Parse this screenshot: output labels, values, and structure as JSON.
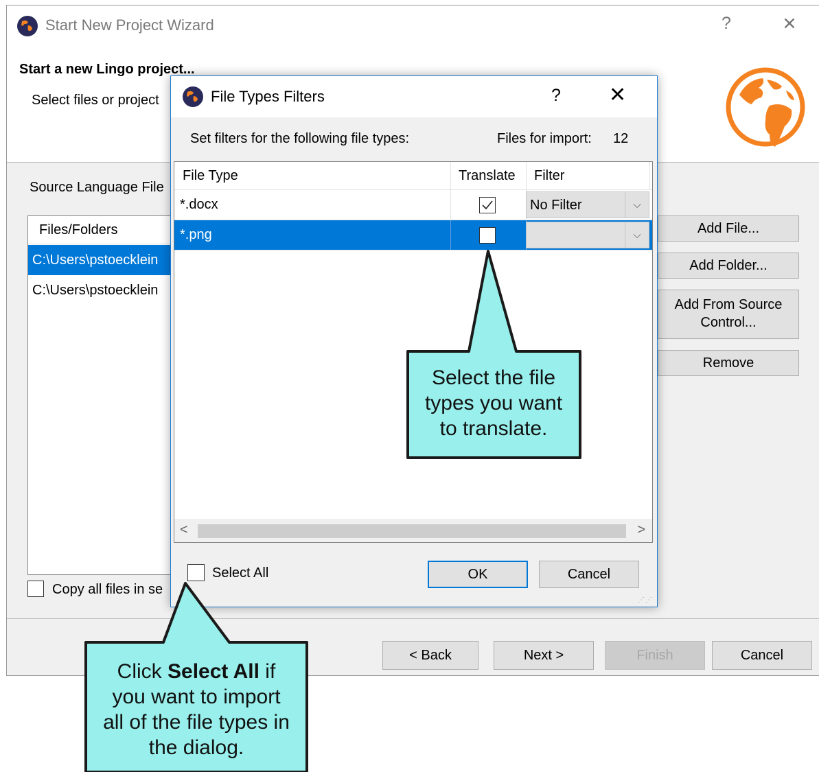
{
  "wizard": {
    "title": "Start New Project Wizard",
    "help_glyph": "?",
    "close_glyph": "✕",
    "header_title": "Start a new Lingo project...",
    "header_subtitle": "Select files or project",
    "logo_icon": "globe-icon",
    "accent_color": "#f58220",
    "section_label": "Source Language File",
    "files_list": {
      "header": "Files/Folders",
      "rows": [
        {
          "path": "C:\\Users\\pstoecklein",
          "selected": true
        },
        {
          "path": "C:\\Users\\pstoecklein",
          "selected": false
        }
      ]
    },
    "side_buttons": {
      "add_file": "Add File...",
      "add_folder": "Add Folder...",
      "add_source_control": "Add From Source Control...",
      "remove": "Remove"
    },
    "copy_label": "Copy all files in se",
    "nav": {
      "back": "< Back",
      "next": "Next >",
      "finish": "Finish",
      "cancel": "Cancel"
    }
  },
  "dialog": {
    "title": "File Types Filters",
    "help_glyph": "?",
    "close_glyph": "✕",
    "instruction": "Set filters for the following file types:",
    "files_for_import_label": "Files for import:",
    "files_for_import_count": "12",
    "columns": [
      "File Type",
      "Translate",
      "Filter"
    ],
    "rows": [
      {
        "file_type": "*.docx",
        "translate": true,
        "filter": "No Filter",
        "selected": false
      },
      {
        "file_type": "*.png",
        "translate": false,
        "filter": "",
        "selected": true
      }
    ],
    "scroll_left": "<",
    "scroll_right": ">",
    "select_all_label": "Select All",
    "select_all_checked": false,
    "ok": "OK",
    "cancel": "Cancel",
    "selection_color": "#0078d7"
  },
  "callouts": {
    "translate": {
      "lines": [
        "Select the file",
        "types you want",
        "to translate."
      ],
      "fill": "#98efeb"
    },
    "select_all": {
      "line1_prefix": "Click ",
      "line1_bold": "Select All",
      "line1_suffix": " if",
      "line2": "you want to import",
      "line3": "all of the file types in",
      "line4": "the dialog.",
      "fill": "#98efeb"
    }
  }
}
